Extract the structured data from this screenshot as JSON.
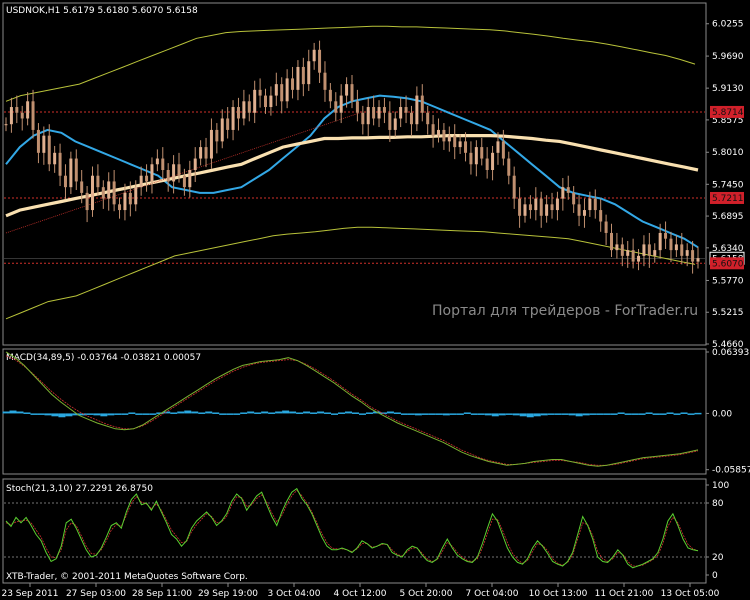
{
  "chart_data": [
    {
      "type": "candlestick",
      "title": "USDNOK,H1  5.6179 5.6180 5.6070 5.6158",
      "watermark": "Портал для трейдеров - ForTrader.ru",
      "ylim": [
        5.466,
        6.06
      ],
      "yticks": [
        "6.0255",
        "5.9690",
        "5.9130",
        "5.8575",
        "5.8010",
        "5.7450",
        "5.6895",
        "5.6340",
        "5.5770",
        "5.5215",
        "5.4660"
      ],
      "price_labels": [
        {
          "text": "5.8714",
          "value": 5.8714,
          "kind": "level"
        },
        {
          "text": "5.7211",
          "value": 5.7211,
          "kind": "level"
        },
        {
          "text": "5.6158",
          "value": 5.6158,
          "kind": "bid"
        },
        {
          "text": "5.6070",
          "value": 5.607,
          "kind": "level"
        }
      ],
      "close": [
        5.85,
        5.88,
        5.87,
        5.86,
        5.89,
        5.84,
        5.8,
        5.83,
        5.78,
        5.8,
        5.76,
        5.74,
        5.79,
        5.75,
        5.73,
        5.7,
        5.76,
        5.74,
        5.72,
        5.75,
        5.71,
        5.7,
        5.73,
        5.71,
        5.74,
        5.76,
        5.75,
        5.78,
        5.79,
        5.77,
        5.75,
        5.78,
        5.76,
        5.74,
        5.77,
        5.79,
        5.81,
        5.79,
        5.84,
        5.82,
        5.86,
        5.84,
        5.88,
        5.86,
        5.89,
        5.87,
        5.91,
        5.9,
        5.88,
        5.9,
        5.92,
        5.89,
        5.93,
        5.91,
        5.95,
        5.92,
        5.96,
        5.98,
        5.94,
        5.91,
        5.89,
        5.87,
        5.9,
        5.92,
        5.89,
        5.87,
        5.85,
        5.88,
        5.86,
        5.88,
        5.87,
        5.84,
        5.86,
        5.88,
        5.87,
        5.85,
        5.9,
        5.87,
        5.85,
        5.83,
        5.84,
        5.82,
        5.83,
        5.81,
        5.82,
        5.8,
        5.78,
        5.81,
        5.79,
        5.77,
        5.8,
        5.82,
        5.79,
        5.76,
        5.72,
        5.69,
        5.71,
        5.7,
        5.72,
        5.69,
        5.71,
        5.7,
        5.72,
        5.74,
        5.73,
        5.71,
        5.69,
        5.7,
        5.72,
        5.7,
        5.68,
        5.66,
        5.63,
        5.64,
        5.62,
        5.63,
        5.61,
        5.62,
        5.64,
        5.62,
        5.63,
        5.66,
        5.65,
        5.63,
        5.64,
        5.62,
        5.63,
        5.61,
        5.6158
      ],
      "series": [
        {
          "name": "",
          "color": "#33a8e6",
          "values": [
            5.78,
            5.81,
            5.83,
            5.84,
            5.835,
            5.82,
            5.81,
            5.8,
            5.79,
            5.78,
            5.77,
            5.76,
            5.74,
            5.735,
            5.73,
            5.73,
            5.735,
            5.74,
            5.755,
            5.77,
            5.79,
            5.81,
            5.83,
            5.86,
            5.88,
            5.89,
            5.895,
            5.9,
            5.898,
            5.895,
            5.89,
            5.88,
            5.87,
            5.86,
            5.85,
            5.84,
            5.82,
            5.8,
            5.78,
            5.76,
            5.74,
            5.73,
            5.725,
            5.72,
            5.71,
            5.695,
            5.68,
            5.67,
            5.66,
            5.65,
            5.635
          ]
        },
        {
          "name": "",
          "color": "#f9e0b0",
          "values": [
            5.69,
            5.7,
            5.705,
            5.71,
            5.715,
            5.72,
            5.725,
            5.73,
            5.735,
            5.74,
            5.745,
            5.75,
            5.755,
            5.76,
            5.765,
            5.77,
            5.775,
            5.78,
            5.79,
            5.8,
            5.81,
            5.815,
            5.82,
            5.825,
            5.825,
            5.826,
            5.826,
            5.827,
            5.827,
            5.828,
            5.828,
            5.829,
            5.83,
            5.83,
            5.83,
            5.83,
            5.829,
            5.827,
            5.825,
            5.822,
            5.82,
            5.815,
            5.81,
            5.805,
            5.8,
            5.795,
            5.79,
            5.785,
            5.78,
            5.775,
            5.77
          ]
        },
        {
          "name": "",
          "color": "#b8c23a",
          "values": [
            5.89,
            5.9,
            5.905,
            5.91,
            5.915,
            5.92,
            5.93,
            5.94,
            5.95,
            5.96,
            5.97,
            5.98,
            5.99,
            6.0,
            6.005,
            6.01,
            6.012,
            6.013,
            6.014,
            6.015,
            6.016,
            6.017,
            6.018,
            6.019,
            6.02,
            6.021,
            6.021,
            6.02,
            6.02,
            6.019,
            6.018,
            6.017,
            6.016,
            6.015,
            6.013,
            6.01,
            6.007,
            6.004,
            6.0,
            5.997,
            5.994,
            5.99,
            5.985,
            5.98,
            5.975,
            5.97,
            5.963,
            5.955
          ]
        },
        {
          "name": "",
          "color": "#b8c23a",
          "values": [
            5.51,
            5.52,
            5.53,
            5.54,
            5.545,
            5.55,
            5.56,
            5.57,
            5.58,
            5.59,
            5.6,
            5.61,
            5.62,
            5.625,
            5.63,
            5.635,
            5.64,
            5.645,
            5.65,
            5.655,
            5.658,
            5.66,
            5.662,
            5.665,
            5.668,
            5.67,
            5.67,
            5.669,
            5.668,
            5.667,
            5.666,
            5.665,
            5.664,
            5.663,
            5.662,
            5.66,
            5.658,
            5.656,
            5.654,
            5.652,
            5.65,
            5.645,
            5.64,
            5.635,
            5.63,
            5.625,
            5.62,
            5.615,
            5.61,
            5.605
          ]
        }
      ]
    },
    {
      "type": "line",
      "title": "MACD(34,89,5) -0.03764 -0.03821 0.00057",
      "ylim": [
        -0.062,
        0.066
      ],
      "yticks": [
        "0.06393",
        "0.00",
        "-0.05857"
      ],
      "histogram": [
        0.002,
        0.003,
        0.002,
        0.001,
        0.0,
        -0.001,
        -0.002,
        -0.003,
        -0.004,
        -0.003,
        -0.002,
        -0.002,
        -0.001,
        -0.002,
        -0.003,
        -0.002,
        -0.001,
        0.0,
        0.001,
        0.0,
        -0.001,
        0.0,
        0.001,
        0.002,
        0.001,
        0.002,
        0.003,
        0.002,
        0.001,
        0.002,
        0.001,
        0.0,
        -0.001,
        0.0,
        0.001,
        0.002,
        0.001,
        0.002,
        0.001,
        0.002,
        0.003,
        0.002,
        0.001,
        0.002,
        0.001,
        0.002,
        0.001,
        0.0,
        0.001,
        0.002,
        0.001,
        0.0,
        0.001,
        0.002,
        0.001,
        0.002,
        0.001,
        0.0,
        -0.001,
        -0.002,
        -0.001,
        0.0,
        -0.001,
        -0.002,
        -0.001,
        0.0,
        0.001,
        0.0,
        -0.001,
        -0.002,
        -0.003,
        -0.002,
        -0.001,
        -0.002,
        -0.003,
        -0.004,
        -0.003,
        -0.002,
        -0.001,
        0.0,
        -0.001,
        -0.002,
        -0.003,
        -0.002,
        -0.001,
        0.0,
        -0.001,
        0.0,
        0.001,
        0.0,
        -0.001,
        0.0,
        0.001,
        0.0,
        0.0,
        0.001,
        0.0,
        0.001,
        0.0,
        0.0006
      ],
      "macd": [
        0.064,
        0.058,
        0.05,
        0.04,
        0.03,
        0.02,
        0.012,
        0.005,
        -0.002,
        -0.006,
        -0.01,
        -0.013,
        -0.016,
        -0.017,
        -0.016,
        -0.012,
        -0.006,
        0.0,
        0.006,
        0.012,
        0.018,
        0.024,
        0.03,
        0.036,
        0.041,
        0.046,
        0.05,
        0.052,
        0.054,
        0.055,
        0.056,
        0.058,
        0.055,
        0.05,
        0.044,
        0.038,
        0.032,
        0.025,
        0.018,
        0.012,
        0.005,
        0.0,
        -0.005,
        -0.01,
        -0.014,
        -0.018,
        -0.022,
        -0.026,
        -0.03,
        -0.035,
        -0.04,
        -0.044,
        -0.047,
        -0.05,
        -0.052,
        -0.054,
        -0.053,
        -0.052,
        -0.05,
        -0.049,
        -0.048,
        -0.048,
        -0.05,
        -0.052,
        -0.054,
        -0.055,
        -0.054,
        -0.052,
        -0.05,
        -0.048,
        -0.046,
        -0.045,
        -0.044,
        -0.043,
        -0.042,
        -0.04,
        -0.038
      ],
      "signal": [
        0.06,
        0.056,
        0.049,
        0.041,
        0.032,
        0.023,
        0.015,
        0.008,
        0.002,
        -0.003,
        -0.007,
        -0.011,
        -0.014,
        -0.016,
        -0.016,
        -0.013,
        -0.008,
        -0.002,
        0.004,
        0.01,
        0.016,
        0.022,
        0.028,
        0.034,
        0.039,
        0.044,
        0.048,
        0.051,
        0.053,
        0.054,
        0.055,
        0.056,
        0.055,
        0.051,
        0.046,
        0.04,
        0.034,
        0.027,
        0.02,
        0.014,
        0.007,
        0.002,
        -0.003,
        -0.008,
        -0.012,
        -0.016,
        -0.02,
        -0.024,
        -0.028,
        -0.033,
        -0.038,
        -0.042,
        -0.046,
        -0.049,
        -0.051,
        -0.053,
        -0.053,
        -0.052,
        -0.051,
        -0.05,
        -0.049,
        -0.049,
        -0.05,
        -0.051,
        -0.053,
        -0.054,
        -0.054,
        -0.053,
        -0.051,
        -0.049,
        -0.047,
        -0.046,
        -0.045,
        -0.044,
        -0.043,
        -0.041,
        -0.039
      ]
    },
    {
      "type": "line",
      "title": "Stoch(21,3,10) 27.2291 26.8750",
      "footer": "XTB-Trader, © 2001-2011 MetaQuotes Software Corp.",
      "ylim": [
        0,
        100
      ],
      "yticks": [
        "100",
        "80",
        "20",
        "0"
      ],
      "levels": [
        80,
        20
      ],
      "k": [
        60,
        54,
        64,
        58,
        64,
        55,
        45,
        38,
        25,
        15,
        18,
        32,
        58,
        62,
        52,
        40,
        28,
        20,
        22,
        30,
        42,
        55,
        58,
        52,
        70,
        84,
        90,
        78,
        80,
        72,
        82,
        70,
        58,
        45,
        40,
        32,
        38,
        52,
        60,
        65,
        70,
        64,
        55,
        60,
        68,
        82,
        90,
        85,
        72,
        80,
        88,
        92,
        78,
        65,
        55,
        70,
        82,
        92,
        96,
        85,
        78,
        68,
        55,
        42,
        32,
        28,
        28,
        30,
        28,
        25,
        30,
        38,
        35,
        30,
        32,
        35,
        34,
        25,
        22,
        20,
        28,
        32,
        30,
        22,
        16,
        14,
        18,
        30,
        40,
        30,
        22,
        18,
        15,
        14,
        20,
        35,
        52,
        68,
        60,
        45,
        30,
        20,
        14,
        12,
        18,
        30,
        38,
        32,
        24,
        15,
        12,
        10,
        15,
        25,
        45,
        65,
        55,
        40,
        20,
        15,
        14,
        20,
        28,
        22,
        12,
        8,
        10,
        12,
        15,
        18,
        25,
        40,
        60,
        68,
        55,
        40,
        30,
        28,
        27
      ],
      "d": [
        58,
        56,
        59,
        60,
        61,
        58,
        50,
        42,
        30,
        20,
        19,
        28,
        50,
        58,
        55,
        44,
        32,
        24,
        23,
        28,
        38,
        50,
        56,
        54,
        66,
        80,
        87,
        81,
        79,
        74,
        79,
        72,
        61,
        50,
        43,
        36,
        37,
        48,
        56,
        62,
        68,
        65,
        58,
        59,
        65,
        78,
        87,
        86,
        76,
        78,
        85,
        89,
        81,
        69,
        59,
        66,
        78,
        88,
        94,
        88,
        80,
        70,
        58,
        46,
        36,
        30,
        29,
        29,
        28,
        26,
        29,
        35,
        35,
        31,
        32,
        34,
        34,
        28,
        23,
        21,
        26,
        30,
        30,
        24,
        18,
        15,
        17,
        26,
        36,
        32,
        25,
        20,
        16,
        15,
        18,
        30,
        46,
        62,
        62,
        50,
        36,
        24,
        17,
        13,
        16,
        26,
        35,
        33,
        27,
        18,
        13,
        11,
        14,
        22,
        40,
        58,
        56,
        44,
        26,
        18,
        15,
        18,
        25,
        23,
        15,
        10,
        10,
        11,
        14,
        17,
        22,
        35,
        54,
        64,
        58,
        45,
        34,
        29,
        26.9
      ]
    }
  ],
  "xticks": [
    "23 Sep 2011",
    "27 Sep 03:00",
    "28 Sep 11:00",
    "29 Sep 19:00",
    "3 Oct 04:00",
    "4 Oct 12:00",
    "5 Oct 20:00",
    "7 Oct 04:00",
    "10 Oct 13:00",
    "11 Oct 21:00",
    "13 Oct 05:00"
  ]
}
